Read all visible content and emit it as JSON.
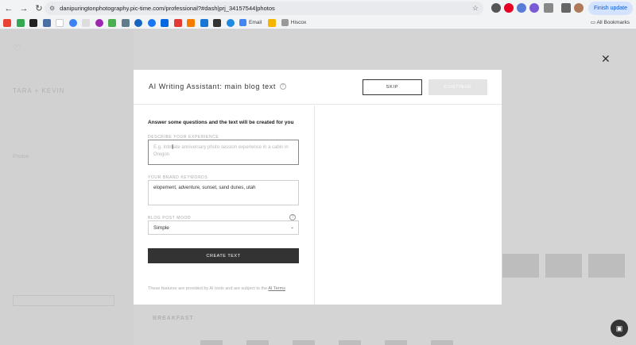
{
  "browser": {
    "url": "danipuringtonphotography.pic-time.com/professional?#dash|prj_34157544|photos",
    "finish_update": "Finish update",
    "bookmarks": [
      {
        "label": "Email"
      },
      {
        "label": "Hiscox"
      }
    ],
    "all_bookmarks": "All Bookmarks"
  },
  "background": {
    "project_title": "TARA + KEVIN",
    "menu_item": "Photos",
    "section": "BREAKFAST"
  },
  "modal": {
    "title": "AI Writing Assistant: main blog text",
    "skip_label": "SKIP",
    "continue_label": "CONTINUE",
    "intro": "Answer some questions and the text will be created for you",
    "experience": {
      "label": "DESCRIBE YOUR EXPERIENCE",
      "placeholder": "E.g. Intimate anniversary photo session experience in a cabin in Oregon"
    },
    "keywords": {
      "label": "YOUR BRAND KEYWORDS",
      "value": "elopement, adventure, sunset, sand dunes, utah"
    },
    "mood": {
      "label": "BLOG POST MOOD",
      "value": "Simple"
    },
    "create_label": "CREATE TEXT",
    "footer_text": "These features are provided by AI tools and are subject to the ",
    "footer_link": "AI Terms"
  },
  "colors": {
    "accent_dark": "#333333",
    "disabled": "#e4e4e4"
  }
}
